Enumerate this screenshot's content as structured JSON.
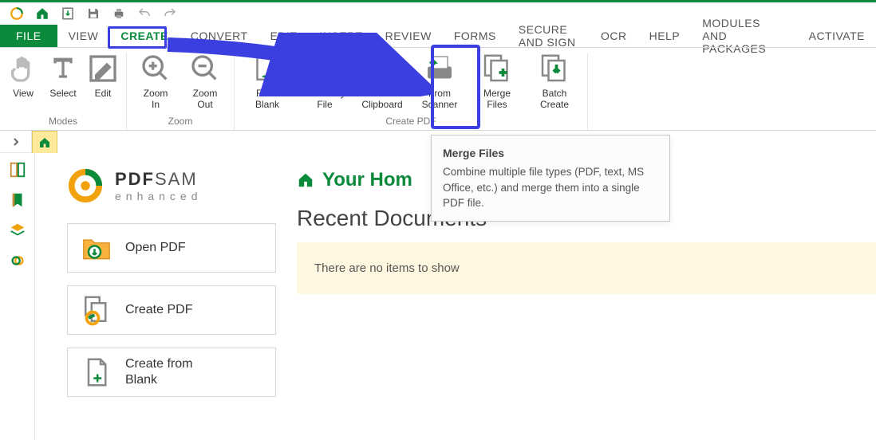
{
  "menu": {
    "file": "FILE",
    "items": [
      "VIEW",
      "CREATE",
      "CONVERT",
      "EDIT",
      "INSERT",
      "REVIEW",
      "FORMS",
      "SECURE AND SIGN",
      "OCR",
      "HELP",
      "MODULES AND PACKAGES",
      "ACTIVATE"
    ]
  },
  "ribbon": {
    "groups": {
      "modes": {
        "name": "Modes",
        "view": "View",
        "select": "Select",
        "edit": "Edit"
      },
      "zoom": {
        "name": "Zoom",
        "in": "Zoom\nIn",
        "out": "Zoom\nOut"
      },
      "createpdf": {
        "name": "Create PDF",
        "blank": "From\nBlank",
        "anyfile": "From Any\nFile",
        "clipboard": "From\nClipboard",
        "scanner": "From\nScanner",
        "merge": "Merge\nFiles",
        "batch": "Batch\nCreate"
      }
    }
  },
  "tooltip": {
    "title": "Merge Files",
    "body": "Combine multiple file types (PDF, text, MS Office, etc.) and merge them into a single PDF file."
  },
  "brand": {
    "main": "PDF",
    "sam": "SAM",
    "sub": "enhanced"
  },
  "home": {
    "cards": {
      "open": "Open PDF",
      "create": "Create PDF",
      "blank": "Create from\nBlank"
    },
    "your_home": "Your Hom",
    "recent_title": "Recent Documents",
    "recent_empty": "There are no items to show"
  }
}
